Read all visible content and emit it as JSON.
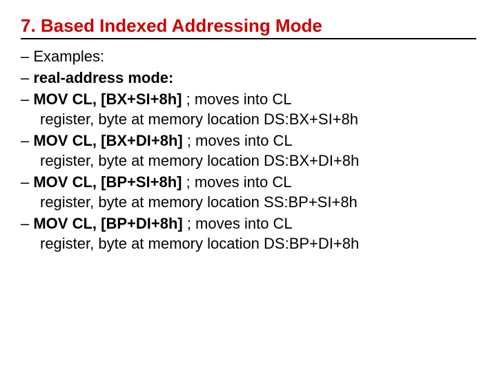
{
  "heading": "7. Based Indexed Addressing Mode",
  "items": {
    "examples_label": "Examples:",
    "real_address_mode": "real-address mode:",
    "mov1_code": "MOV CL, [BX+SI+8h]",
    "mov1_comment": "   ; moves into CL",
    "mov1_line2": "register, byte at memory location DS:BX+SI+8h",
    "mov2_code": "MOV CL, [BX+DI+8h]",
    "mov2_comment": "   ; moves into CL",
    "mov2_line2": "register, byte at memory location DS:BX+DI+8h",
    "mov3_code": "MOV CL, [BP+SI+8h]",
    "mov3_comment": "   ; moves into CL",
    "mov3_line2": "register, byte at memory location SS:BP+SI+8h",
    "mov4_code": "MOV CL, [BP+DI+8h]",
    "mov4_comment": "   ; moves into CL",
    "mov4_line2": "register, byte at memory location DS:BP+DI+8h"
  }
}
